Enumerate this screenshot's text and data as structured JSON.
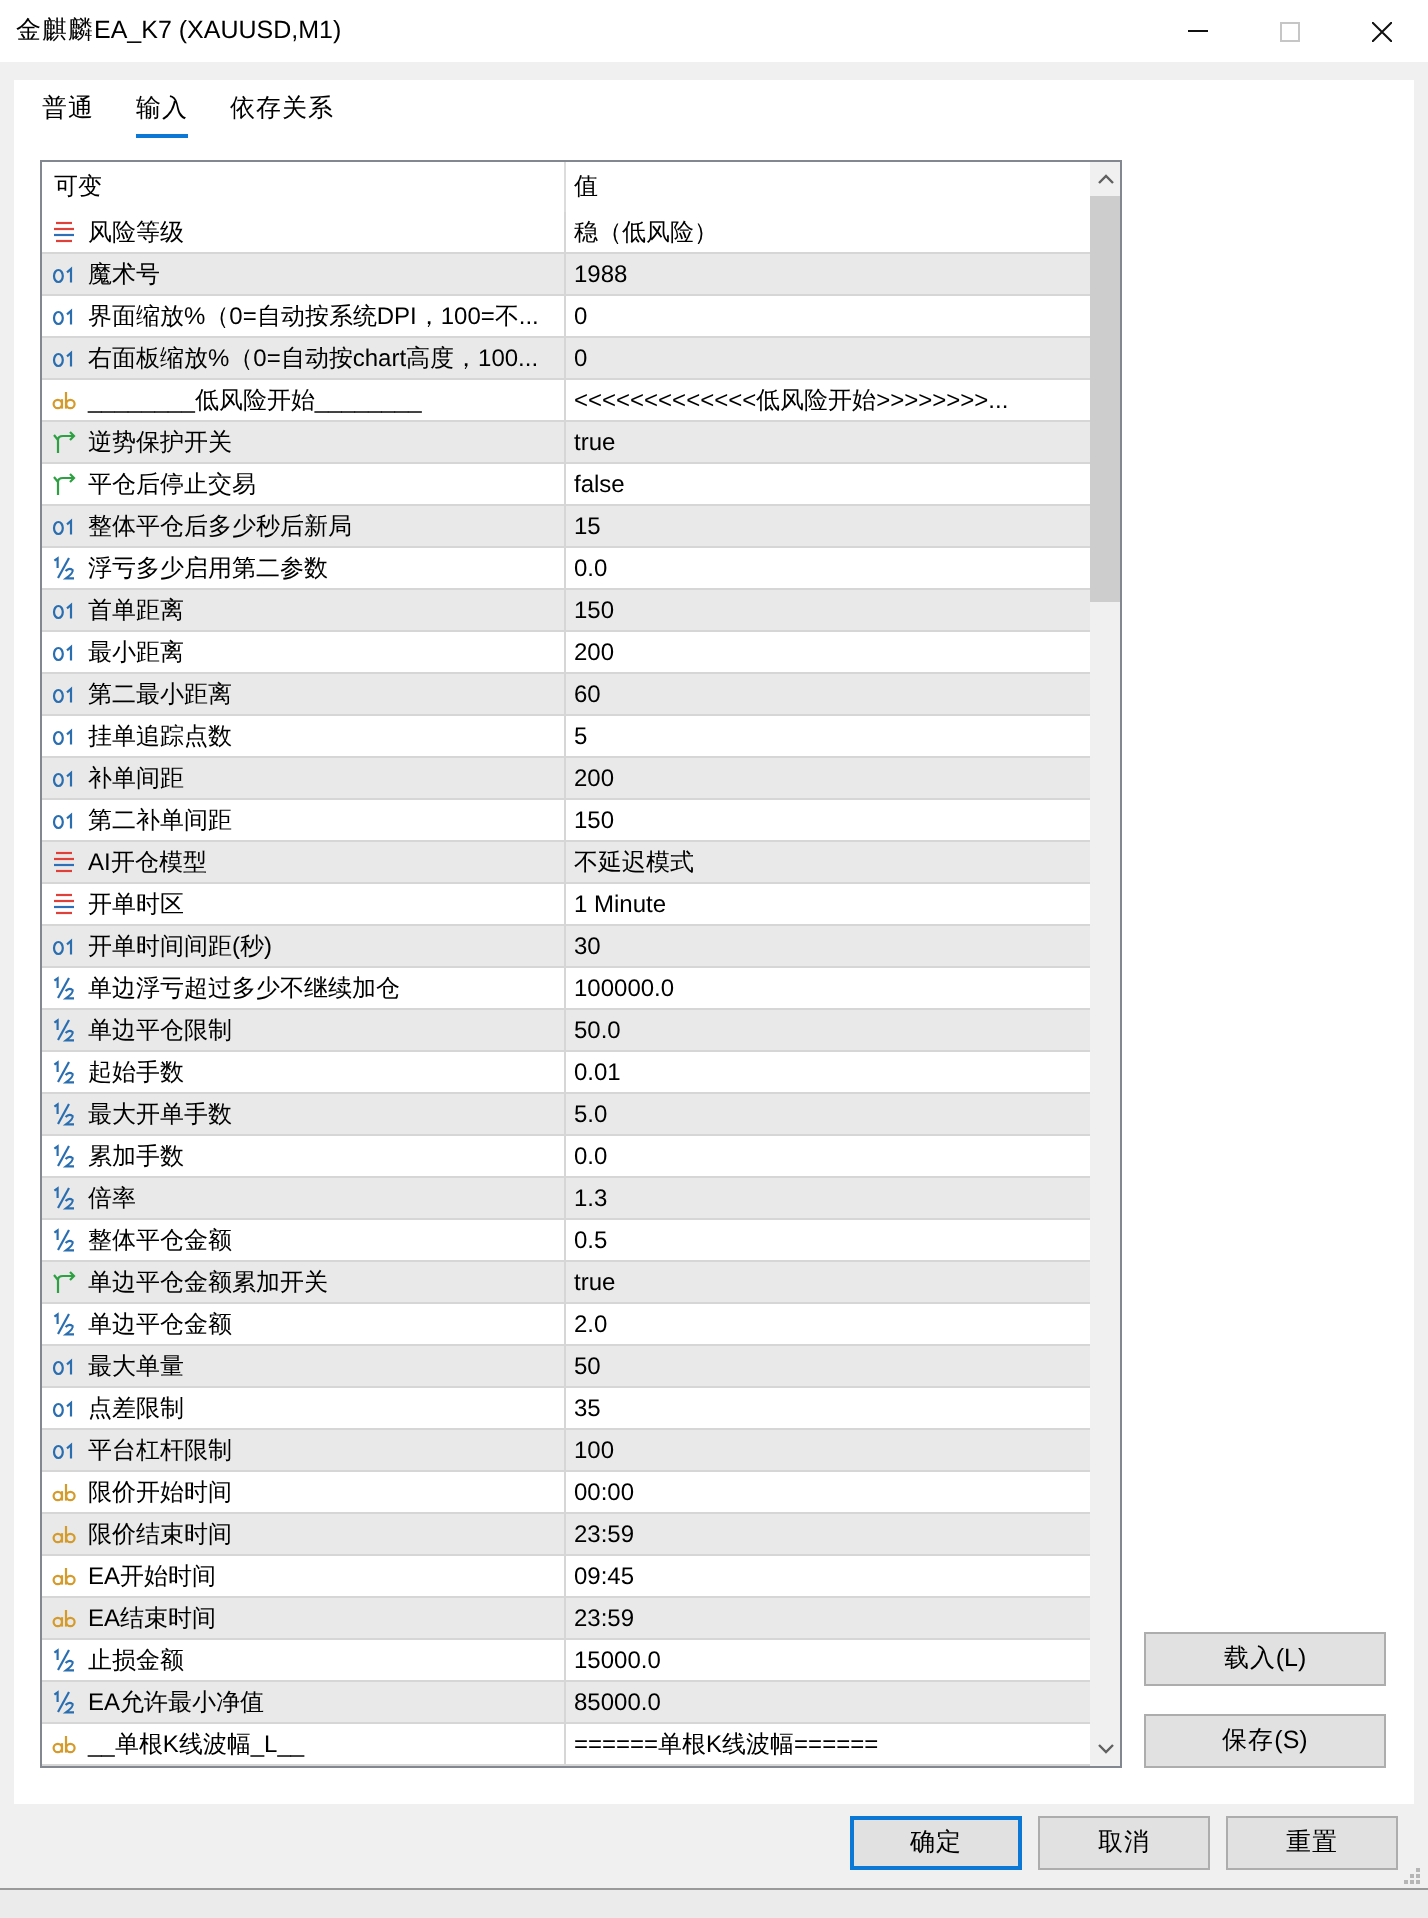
{
  "window": {
    "title": "金麒麟EA_K7 (XAUUSD,M1)",
    "controls": [
      {
        "kind": "minimize",
        "disabled": false
      },
      {
        "kind": "maximize",
        "disabled": true
      },
      {
        "kind": "close",
        "disabled": false
      }
    ]
  },
  "tabs": [
    {
      "label": "普通",
      "selected": false
    },
    {
      "label": "输入",
      "selected": true
    },
    {
      "label": "依存关系",
      "selected": false
    }
  ],
  "table": {
    "columns": [
      "可变",
      "值"
    ],
    "rows": [
      {
        "kind": "enum",
        "name": "风险等级",
        "value": "稳（低风险）"
      },
      {
        "kind": "int",
        "name": "魔术号",
        "value": "1988"
      },
      {
        "kind": "int",
        "name": "界面缩放%（0=自动按系统DPI，100=不...",
        "value": "0"
      },
      {
        "kind": "int",
        "name": "右面板缩放%（0=自动按chart高度，100...",
        "value": "0"
      },
      {
        "kind": "string",
        "name": "________低风险开始________",
        "value": "<<<<<<<<<<<<<低风险开始>>>>>>>>..."
      },
      {
        "kind": "bool",
        "name": "逆势保护开关",
        "value": "true"
      },
      {
        "kind": "bool",
        "name": "平仓后停止交易",
        "value": "false"
      },
      {
        "kind": "int",
        "name": "整体平仓后多少秒后新局",
        "value": "15"
      },
      {
        "kind": "double",
        "name": "浮亏多少启用第二参数",
        "value": "0.0"
      },
      {
        "kind": "int",
        "name": "首单距离",
        "value": "150"
      },
      {
        "kind": "int",
        "name": "最小距离",
        "value": "200"
      },
      {
        "kind": "int",
        "name": "第二最小距离",
        "value": "60"
      },
      {
        "kind": "int",
        "name": "挂单追踪点数",
        "value": "5"
      },
      {
        "kind": "int",
        "name": "补单间距",
        "value": "200"
      },
      {
        "kind": "int",
        "name": "第二补单间距",
        "value": "150"
      },
      {
        "kind": "enum",
        "name": "AI开仓模型",
        "value": "不延迟模式"
      },
      {
        "kind": "enum",
        "name": "开单时区",
        "value": "1 Minute"
      },
      {
        "kind": "int",
        "name": "开单时间间距(秒)",
        "value": "30"
      },
      {
        "kind": "double",
        "name": "单边浮亏超过多少不继续加仓",
        "value": "100000.0"
      },
      {
        "kind": "double",
        "name": "单边平仓限制",
        "value": "50.0"
      },
      {
        "kind": "double",
        "name": "起始手数",
        "value": "0.01"
      },
      {
        "kind": "double",
        "name": "最大开单手数",
        "value": "5.0"
      },
      {
        "kind": "double",
        "name": "累加手数",
        "value": "0.0"
      },
      {
        "kind": "double",
        "name": "倍率",
        "value": "1.3"
      },
      {
        "kind": "double",
        "name": "整体平仓金额",
        "value": "0.5"
      },
      {
        "kind": "bool",
        "name": "单边平仓金额累加开关",
        "value": "true"
      },
      {
        "kind": "double",
        "name": "单边平仓金额",
        "value": "2.0"
      },
      {
        "kind": "int",
        "name": "最大单量",
        "value": "50"
      },
      {
        "kind": "int",
        "name": "点差限制",
        "value": "35"
      },
      {
        "kind": "int",
        "name": "平台杠杆限制",
        "value": "100"
      },
      {
        "kind": "string",
        "name": "限价开始时间",
        "value": "00:00"
      },
      {
        "kind": "string",
        "name": "限价结束时间",
        "value": "23:59"
      },
      {
        "kind": "string",
        "name": "EA开始时间",
        "value": "09:45"
      },
      {
        "kind": "string",
        "name": "EA结束时间",
        "value": "23:59"
      },
      {
        "kind": "double",
        "name": "止损金额",
        "value": "15000.0"
      },
      {
        "kind": "double",
        "name": "EA允许最小净值",
        "value": "85000.0"
      },
      {
        "kind": "string",
        "name": "__单根K线波幅_L__",
        "value": "======单根K线波幅======"
      }
    ]
  },
  "side_buttons": [
    "载入(L)",
    "保存(S)"
  ],
  "buttons": [
    {
      "label": "确定",
      "default": true
    },
    {
      "label": "取消",
      "default": false
    },
    {
      "label": "重置",
      "default": false
    }
  ]
}
